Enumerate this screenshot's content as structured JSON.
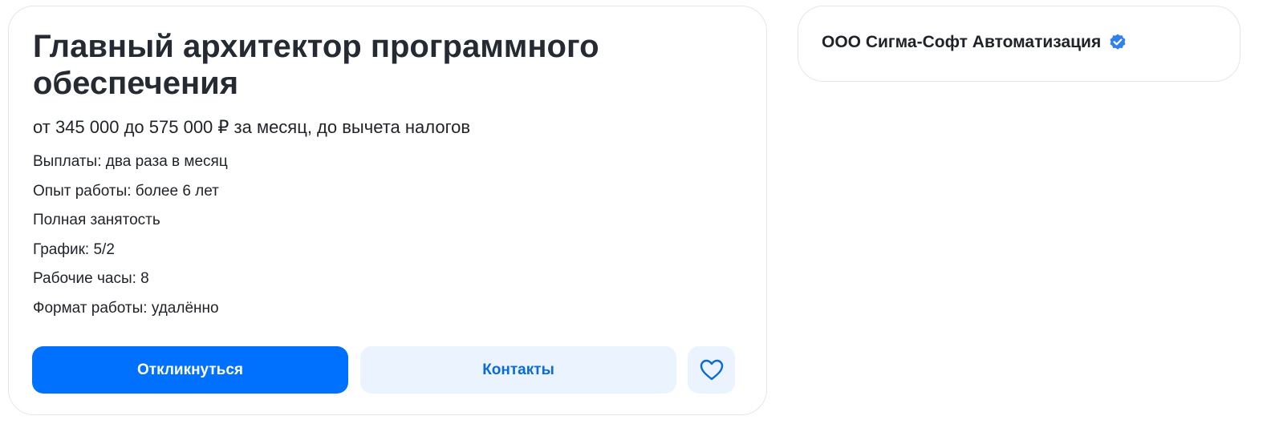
{
  "vacancy": {
    "title": "Главный архитектор программного обеспечения",
    "salary": "от 345 000 до 575 000 ₽ за месяц, до вычета налогов",
    "details": [
      "Выплаты: два раза в месяц",
      "Опыт работы: более 6 лет",
      "Полная занятость",
      "График: 5/2",
      "Рабочие часы: 8",
      "Формат работы: удалённо"
    ],
    "buttons": {
      "respond_label": "Откликнуться",
      "contacts_label": "Контакты",
      "favorite_icon": "heart-icon"
    }
  },
  "company": {
    "name": "ООО Сигма-Софт Автоматизация",
    "verified_icon": "verified-badge-icon"
  },
  "colors": {
    "primary": "#0070ff",
    "secondary_bg": "#eaf3ff",
    "secondary_text": "#0a6ad8",
    "verified": "#2f80ed"
  }
}
